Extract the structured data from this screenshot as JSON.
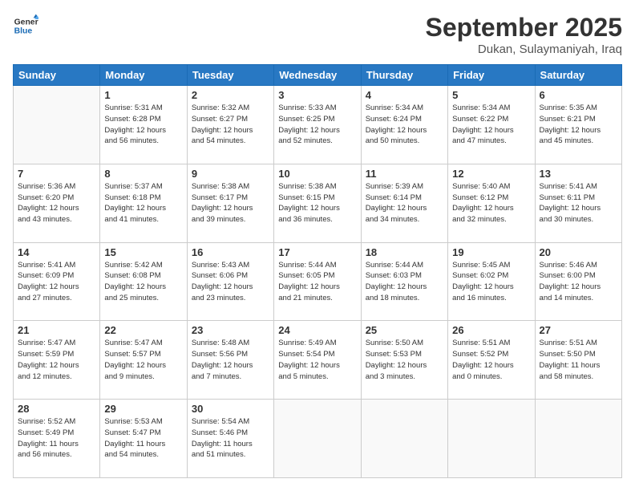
{
  "header": {
    "logo_line1": "General",
    "logo_line2": "Blue",
    "month": "September 2025",
    "location": "Dukan, Sulaymaniyah, Iraq"
  },
  "days_of_week": [
    "Sunday",
    "Monday",
    "Tuesday",
    "Wednesday",
    "Thursday",
    "Friday",
    "Saturday"
  ],
  "weeks": [
    [
      {
        "day": "",
        "info": ""
      },
      {
        "day": "1",
        "info": "Sunrise: 5:31 AM\nSunset: 6:28 PM\nDaylight: 12 hours\nand 56 minutes."
      },
      {
        "day": "2",
        "info": "Sunrise: 5:32 AM\nSunset: 6:27 PM\nDaylight: 12 hours\nand 54 minutes."
      },
      {
        "day": "3",
        "info": "Sunrise: 5:33 AM\nSunset: 6:25 PM\nDaylight: 12 hours\nand 52 minutes."
      },
      {
        "day": "4",
        "info": "Sunrise: 5:34 AM\nSunset: 6:24 PM\nDaylight: 12 hours\nand 50 minutes."
      },
      {
        "day": "5",
        "info": "Sunrise: 5:34 AM\nSunset: 6:22 PM\nDaylight: 12 hours\nand 47 minutes."
      },
      {
        "day": "6",
        "info": "Sunrise: 5:35 AM\nSunset: 6:21 PM\nDaylight: 12 hours\nand 45 minutes."
      }
    ],
    [
      {
        "day": "7",
        "info": "Sunrise: 5:36 AM\nSunset: 6:20 PM\nDaylight: 12 hours\nand 43 minutes."
      },
      {
        "day": "8",
        "info": "Sunrise: 5:37 AM\nSunset: 6:18 PM\nDaylight: 12 hours\nand 41 minutes."
      },
      {
        "day": "9",
        "info": "Sunrise: 5:38 AM\nSunset: 6:17 PM\nDaylight: 12 hours\nand 39 minutes."
      },
      {
        "day": "10",
        "info": "Sunrise: 5:38 AM\nSunset: 6:15 PM\nDaylight: 12 hours\nand 36 minutes."
      },
      {
        "day": "11",
        "info": "Sunrise: 5:39 AM\nSunset: 6:14 PM\nDaylight: 12 hours\nand 34 minutes."
      },
      {
        "day": "12",
        "info": "Sunrise: 5:40 AM\nSunset: 6:12 PM\nDaylight: 12 hours\nand 32 minutes."
      },
      {
        "day": "13",
        "info": "Sunrise: 5:41 AM\nSunset: 6:11 PM\nDaylight: 12 hours\nand 30 minutes."
      }
    ],
    [
      {
        "day": "14",
        "info": "Sunrise: 5:41 AM\nSunset: 6:09 PM\nDaylight: 12 hours\nand 27 minutes."
      },
      {
        "day": "15",
        "info": "Sunrise: 5:42 AM\nSunset: 6:08 PM\nDaylight: 12 hours\nand 25 minutes."
      },
      {
        "day": "16",
        "info": "Sunrise: 5:43 AM\nSunset: 6:06 PM\nDaylight: 12 hours\nand 23 minutes."
      },
      {
        "day": "17",
        "info": "Sunrise: 5:44 AM\nSunset: 6:05 PM\nDaylight: 12 hours\nand 21 minutes."
      },
      {
        "day": "18",
        "info": "Sunrise: 5:44 AM\nSunset: 6:03 PM\nDaylight: 12 hours\nand 18 minutes."
      },
      {
        "day": "19",
        "info": "Sunrise: 5:45 AM\nSunset: 6:02 PM\nDaylight: 12 hours\nand 16 minutes."
      },
      {
        "day": "20",
        "info": "Sunrise: 5:46 AM\nSunset: 6:00 PM\nDaylight: 12 hours\nand 14 minutes."
      }
    ],
    [
      {
        "day": "21",
        "info": "Sunrise: 5:47 AM\nSunset: 5:59 PM\nDaylight: 12 hours\nand 12 minutes."
      },
      {
        "day": "22",
        "info": "Sunrise: 5:47 AM\nSunset: 5:57 PM\nDaylight: 12 hours\nand 9 minutes."
      },
      {
        "day": "23",
        "info": "Sunrise: 5:48 AM\nSunset: 5:56 PM\nDaylight: 12 hours\nand 7 minutes."
      },
      {
        "day": "24",
        "info": "Sunrise: 5:49 AM\nSunset: 5:54 PM\nDaylight: 12 hours\nand 5 minutes."
      },
      {
        "day": "25",
        "info": "Sunrise: 5:50 AM\nSunset: 5:53 PM\nDaylight: 12 hours\nand 3 minutes."
      },
      {
        "day": "26",
        "info": "Sunrise: 5:51 AM\nSunset: 5:52 PM\nDaylight: 12 hours\nand 0 minutes."
      },
      {
        "day": "27",
        "info": "Sunrise: 5:51 AM\nSunset: 5:50 PM\nDaylight: 11 hours\nand 58 minutes."
      }
    ],
    [
      {
        "day": "28",
        "info": "Sunrise: 5:52 AM\nSunset: 5:49 PM\nDaylight: 11 hours\nand 56 minutes."
      },
      {
        "day": "29",
        "info": "Sunrise: 5:53 AM\nSunset: 5:47 PM\nDaylight: 11 hours\nand 54 minutes."
      },
      {
        "day": "30",
        "info": "Sunrise: 5:54 AM\nSunset: 5:46 PM\nDaylight: 11 hours\nand 51 minutes."
      },
      {
        "day": "",
        "info": ""
      },
      {
        "day": "",
        "info": ""
      },
      {
        "day": "",
        "info": ""
      },
      {
        "day": "",
        "info": ""
      }
    ]
  ]
}
